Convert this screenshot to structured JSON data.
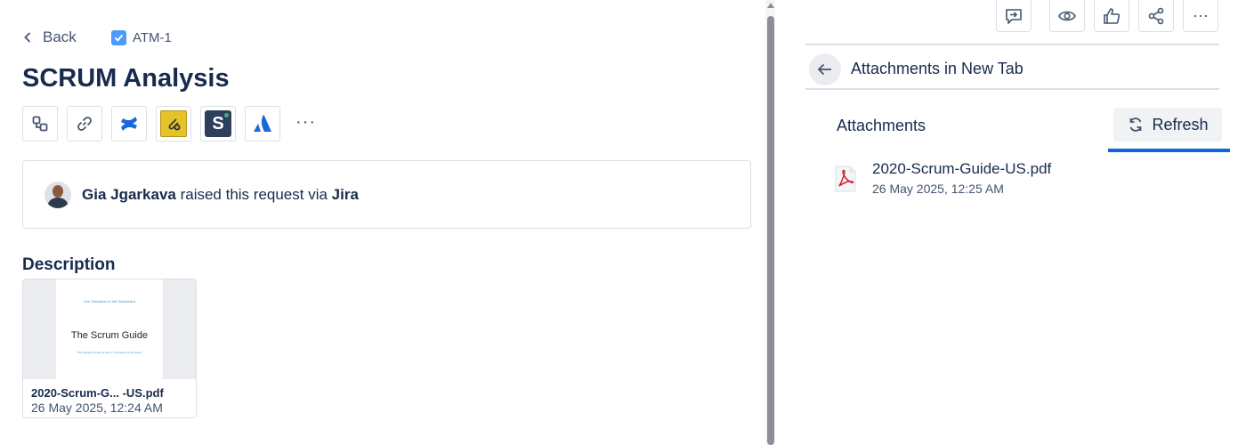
{
  "header": {
    "back_label": "Back",
    "issue_key": "ATM-1",
    "title": "SCRUM Analysis"
  },
  "toolbar": {
    "tools": [
      {
        "icon": "child-issue-icon"
      },
      {
        "icon": "link-icon"
      },
      {
        "icon": "confluence-icon"
      },
      {
        "icon": "attachment-app-icon"
      },
      {
        "icon": "s-app-icon"
      },
      {
        "icon": "atlassian-icon"
      }
    ],
    "more_label": "···"
  },
  "request": {
    "reporter": "Gia Jgarkava",
    "middle_text": " raised this request via ",
    "channel": "Jira"
  },
  "description": {
    "heading": "Description",
    "attachment": {
      "thumb_authors": "Ken Schwaber & Jeff Sutherland",
      "thumb_title": "The Scrum Guide",
      "thumb_subtitle": "The Definitive Guide to Scrum: The Rules of the Game",
      "name": "2020-Scrum-G... -US.pdf",
      "date": "26 May 2025, 12:24 AM"
    }
  },
  "right_panel": {
    "title": "Attachments in New Tab",
    "tab_label": "Attachments",
    "refresh_label": "Refresh",
    "files": [
      {
        "name": "2020-Scrum-Guide-US.pdf",
        "date": "26 May 2025, 12:25 AM"
      }
    ],
    "more_label": "···"
  },
  "colors": {
    "accent": "#0c66e4",
    "checkbox": "#4c9aff",
    "text": "#172b4d",
    "subtle": "#44546f"
  }
}
